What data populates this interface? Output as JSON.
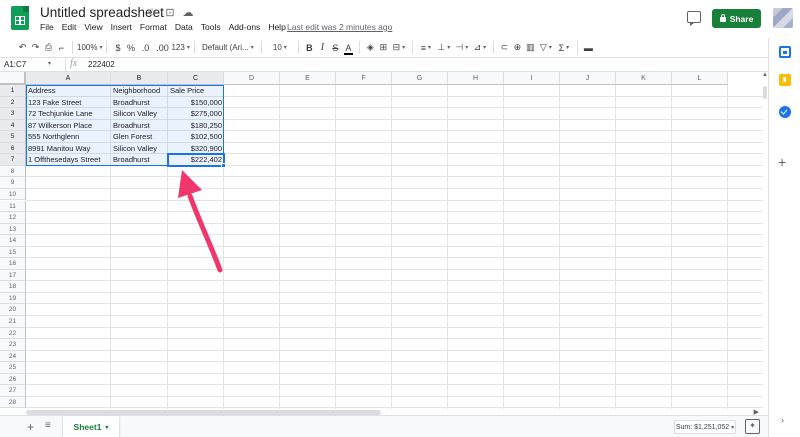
{
  "title": {
    "doc_name": "Untitled spreadsheet",
    "star_icon": "star-icon",
    "move_icon": "folder-move-icon",
    "cloud_icon": "cloud-saved-icon"
  },
  "menu": [
    "File",
    "Edit",
    "View",
    "Insert",
    "Format",
    "Data",
    "Tools",
    "Add-ons",
    "Help"
  ],
  "last_edit": "Last edit was 2 minutes ago",
  "share_label": "Share",
  "toolbar": {
    "zoom": "100%",
    "currency": "$",
    "percent": "%",
    "decrease_decimal": ".0",
    "increase_decimal": ".00",
    "more_formats": "123",
    "font": "Default (Ari...",
    "font_size": "10",
    "bold": "B",
    "italic": "I",
    "strike": "S",
    "text_color": "A"
  },
  "formula_bar": {
    "name_box": "A1:C7",
    "fx": "fx",
    "value": "222402"
  },
  "columns": [
    "A",
    "B",
    "C",
    "D",
    "E",
    "F",
    "G",
    "H",
    "I",
    "J",
    "K",
    "L"
  ],
  "rows": [
    "1",
    "2",
    "3",
    "4",
    "5",
    "6",
    "7",
    "8",
    "9",
    "10",
    "11",
    "12",
    "13",
    "14",
    "15",
    "16",
    "17",
    "18",
    "19",
    "20",
    "21",
    "22",
    "23",
    "24",
    "25",
    "26",
    "27",
    "28"
  ],
  "table": {
    "headers": [
      "Address",
      "Neighborhood",
      "Sale Price"
    ],
    "rows": [
      [
        "123 Fake Street",
        "Broadhurst",
        "$150,000"
      ],
      [
        "72 Techjunkie Lane",
        "Silicon Valley",
        "$275,000"
      ],
      [
        "87 Wilkerson Place",
        "Broadhurst",
        "$180,250"
      ],
      [
        "555 Northglenn",
        "Glen Forest",
        "$102,500"
      ],
      [
        "8991 Manitou Way",
        "Silicon Valley",
        "$320,900"
      ],
      [
        "1 Offthesedays Street",
        "Broadhurst",
        "$222,402"
      ]
    ]
  },
  "bottom": {
    "sheet_name": "Sheet1",
    "sum": "Sum: $1,251,052"
  },
  "colors": {
    "brand_green": "#188038",
    "selection_blue": "#1a73e8",
    "arrow_pink": "#f0366b"
  }
}
